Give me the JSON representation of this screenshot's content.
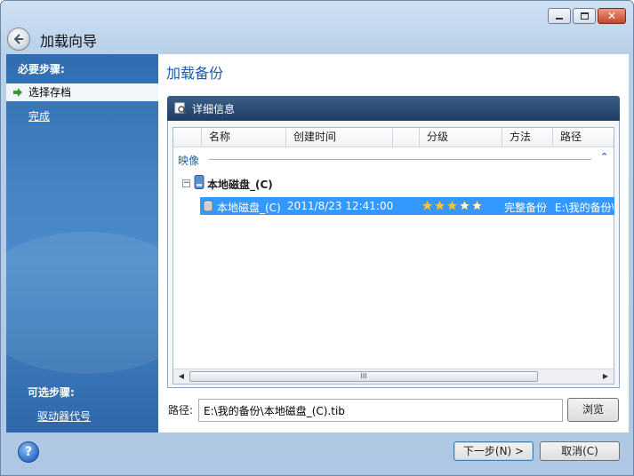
{
  "window": {
    "title": "加载向导"
  },
  "sidebar": {
    "required_heading": "必要步骤:",
    "required_items": [
      {
        "label": "选择存档",
        "active": true
      },
      {
        "label": "完成",
        "active": false
      }
    ],
    "optional_heading": "可选步骤:",
    "optional_items": [
      {
        "label": "驱动器代号"
      }
    ]
  },
  "content": {
    "title": "加载备份",
    "panel_title": "详细信息",
    "columns": [
      "名称",
      "创建时间",
      "分级",
      "方法",
      "路径"
    ],
    "group_label": "映像",
    "tree_node": "本地磁盘_(C)",
    "row": {
      "name": "本地磁盘_(C)",
      "created": "2011/8/23 12:41:00",
      "rating": 5,
      "method": "完整备份",
      "path": "E:\\我的备份\\:"
    },
    "scroll_thumb_glyph": "III",
    "path_label": "路径:",
    "path_value": "E:\\我的备份\\本地磁盘_(C).tib",
    "browse_label": "浏览"
  },
  "footer": {
    "help_glyph": "?",
    "next_label": "下一步(N) >",
    "cancel_label": "取消(C)"
  },
  "colors": {
    "selection": "#3399ff",
    "sidebar": "#3f7ec0",
    "header": "#1c3d64"
  }
}
